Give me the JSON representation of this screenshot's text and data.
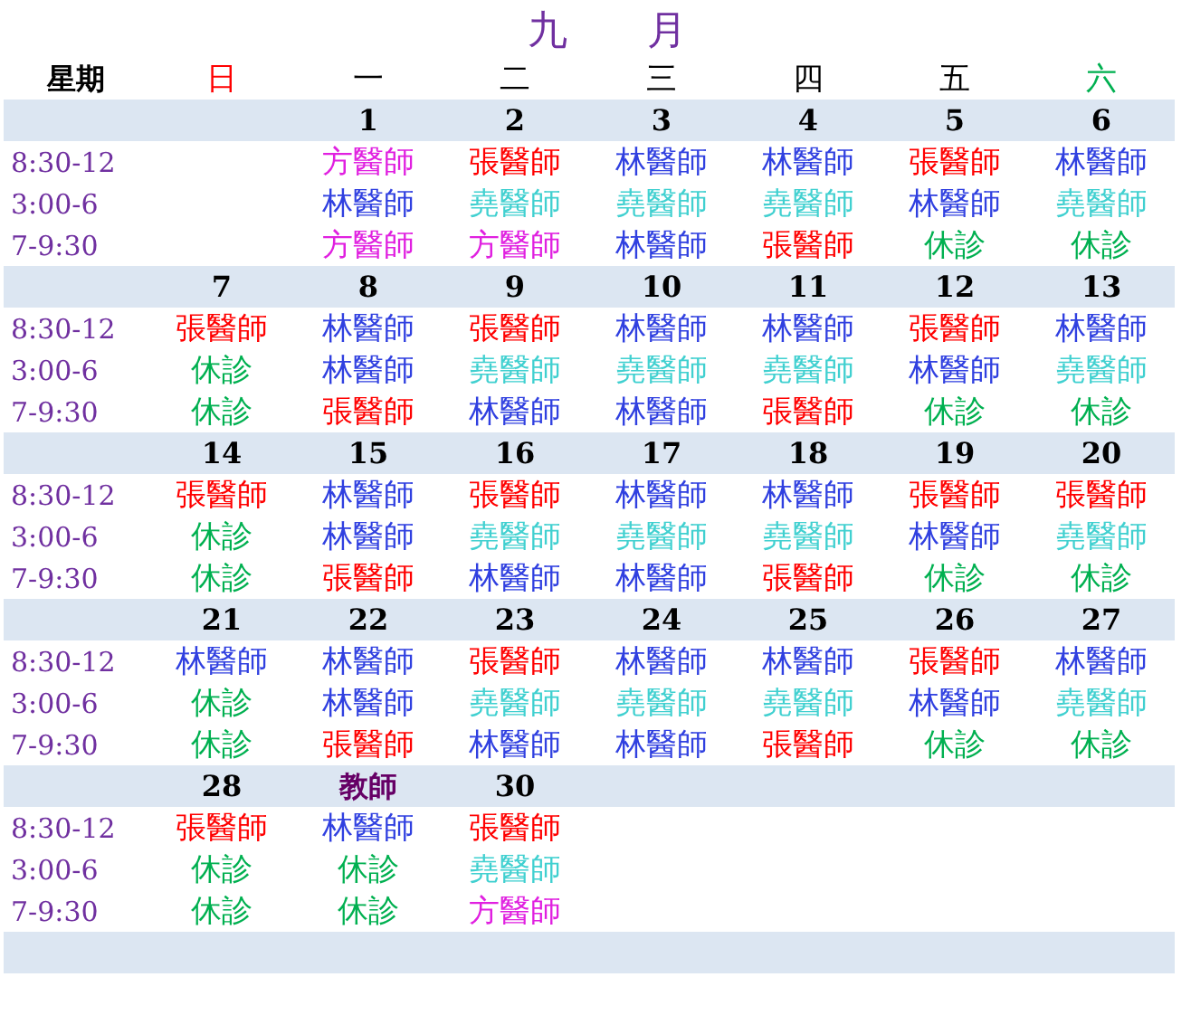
{
  "title": "九　　月",
  "weekday_header": {
    "label": "星期",
    "days": [
      {
        "label": "日",
        "color": "#ff0000"
      },
      {
        "label": "一",
        "color": "#000000"
      },
      {
        "label": "二",
        "color": "#000000"
      },
      {
        "label": "三",
        "color": "#000000"
      },
      {
        "label": "四",
        "color": "#000000"
      },
      {
        "label": "五",
        "color": "#000000"
      },
      {
        "label": "六",
        "color": "#00b050"
      }
    ]
  },
  "weeks": [
    {
      "times": [
        "8:30-12",
        "3:00-6",
        "7-9:30"
      ],
      "days": [
        {
          "kind": "blank"
        },
        {
          "kind": "day",
          "date": {
            "text": "1",
            "color": "#000000"
          },
          "slots": [
            {
              "text": "方醫師",
              "color": "#e020e0"
            },
            {
              "text": "林醫師",
              "color": "#3040e0"
            },
            {
              "text": "方醫師",
              "color": "#e020e0"
            }
          ]
        },
        {
          "kind": "day",
          "date": {
            "text": "2",
            "color": "#000000"
          },
          "slots": [
            {
              "text": "張醫師",
              "color": "#ff0000"
            },
            {
              "text": "堯醫師",
              "color": "#40d0d0"
            },
            {
              "text": "方醫師",
              "color": "#e020e0"
            }
          ]
        },
        {
          "kind": "day",
          "date": {
            "text": "3",
            "color": "#000000"
          },
          "slots": [
            {
              "text": "林醫師",
              "color": "#3040e0"
            },
            {
              "text": "堯醫師",
              "color": "#40d0d0"
            },
            {
              "text": "林醫師",
              "color": "#3040e0"
            }
          ]
        },
        {
          "kind": "day",
          "date": {
            "text": "4",
            "color": "#000000"
          },
          "slots": [
            {
              "text": "林醫師",
              "color": "#3040e0"
            },
            {
              "text": "堯醫師",
              "color": "#40d0d0"
            },
            {
              "text": "張醫師",
              "color": "#ff0000"
            }
          ]
        },
        {
          "kind": "day",
          "date": {
            "text": "5",
            "color": "#000000"
          },
          "slots": [
            {
              "text": "張醫師",
              "color": "#ff0000"
            },
            {
              "text": "林醫師",
              "color": "#3040e0"
            },
            {
              "text": "休診",
              "color": "#00b050"
            }
          ]
        },
        {
          "kind": "day",
          "date": {
            "text": "6",
            "color": "#000000"
          },
          "slots": [
            {
              "text": "林醫師",
              "color": "#3040e0"
            },
            {
              "text": "堯醫師",
              "color": "#40d0d0"
            },
            {
              "text": "休診",
              "color": "#00b050"
            }
          ]
        }
      ]
    },
    {
      "times": [
        "8:30-12",
        "3:00-6",
        "7-9:30"
      ],
      "days": [
        {
          "kind": "day",
          "date": {
            "text": "7",
            "color": "#000000"
          },
          "slots": [
            {
              "text": "張醫師",
              "color": "#ff0000"
            },
            {
              "text": "休診",
              "color": "#00b050"
            },
            {
              "text": "休診",
              "color": "#00b050"
            }
          ]
        },
        {
          "kind": "day",
          "date": {
            "text": "8",
            "color": "#000000"
          },
          "slots": [
            {
              "text": "林醫師",
              "color": "#3040e0"
            },
            {
              "text": "林醫師",
              "color": "#3040e0"
            },
            {
              "text": "張醫師",
              "color": "#ff0000"
            }
          ]
        },
        {
          "kind": "day",
          "date": {
            "text": "9",
            "color": "#000000"
          },
          "slots": [
            {
              "text": "張醫師",
              "color": "#ff0000"
            },
            {
              "text": "堯醫師",
              "color": "#40d0d0"
            },
            {
              "text": "林醫師",
              "color": "#3040e0"
            }
          ]
        },
        {
          "kind": "day",
          "date": {
            "text": "10",
            "color": "#000000"
          },
          "slots": [
            {
              "text": "林醫師",
              "color": "#3040e0"
            },
            {
              "text": "堯醫師",
              "color": "#40d0d0"
            },
            {
              "text": "林醫師",
              "color": "#3040e0"
            }
          ]
        },
        {
          "kind": "day",
          "date": {
            "text": "11",
            "color": "#000000"
          },
          "slots": [
            {
              "text": "林醫師",
              "color": "#3040e0"
            },
            {
              "text": "堯醫師",
              "color": "#40d0d0"
            },
            {
              "text": "張醫師",
              "color": "#ff0000"
            }
          ]
        },
        {
          "kind": "day",
          "date": {
            "text": "12",
            "color": "#000000"
          },
          "slots": [
            {
              "text": "張醫師",
              "color": "#ff0000"
            },
            {
              "text": "林醫師",
              "color": "#3040e0"
            },
            {
              "text": "休診",
              "color": "#00b050"
            }
          ]
        },
        {
          "kind": "day",
          "date": {
            "text": "13",
            "color": "#000000"
          },
          "slots": [
            {
              "text": "林醫師",
              "color": "#3040e0"
            },
            {
              "text": "堯醫師",
              "color": "#40d0d0"
            },
            {
              "text": "休診",
              "color": "#00b050"
            }
          ]
        }
      ]
    },
    {
      "times": [
        "8:30-12",
        "3:00-6",
        "7-9:30"
      ],
      "days": [
        {
          "kind": "day",
          "date": {
            "text": "14",
            "color": "#000000"
          },
          "slots": [
            {
              "text": "張醫師",
              "color": "#ff0000"
            },
            {
              "text": "休診",
              "color": "#00b050"
            },
            {
              "text": "休診",
              "color": "#00b050"
            }
          ]
        },
        {
          "kind": "day",
          "date": {
            "text": "15",
            "color": "#000000"
          },
          "slots": [
            {
              "text": "林醫師",
              "color": "#3040e0"
            },
            {
              "text": "林醫師",
              "color": "#3040e0"
            },
            {
              "text": "張醫師",
              "color": "#ff0000"
            }
          ]
        },
        {
          "kind": "day",
          "date": {
            "text": "16",
            "color": "#000000"
          },
          "slots": [
            {
              "text": "張醫師",
              "color": "#ff0000"
            },
            {
              "text": "堯醫師",
              "color": "#40d0d0"
            },
            {
              "text": "林醫師",
              "color": "#3040e0"
            }
          ]
        },
        {
          "kind": "day",
          "date": {
            "text": "17",
            "color": "#000000"
          },
          "slots": [
            {
              "text": "林醫師",
              "color": "#3040e0"
            },
            {
              "text": "堯醫師",
              "color": "#40d0d0"
            },
            {
              "text": "林醫師",
              "color": "#3040e0"
            }
          ]
        },
        {
          "kind": "day",
          "date": {
            "text": "18",
            "color": "#000000"
          },
          "slots": [
            {
              "text": "林醫師",
              "color": "#3040e0"
            },
            {
              "text": "堯醫師",
              "color": "#40d0d0"
            },
            {
              "text": "張醫師",
              "color": "#ff0000"
            }
          ]
        },
        {
          "kind": "day",
          "date": {
            "text": "19",
            "color": "#000000"
          },
          "slots": [
            {
              "text": "張醫師",
              "color": "#ff0000"
            },
            {
              "text": "林醫師",
              "color": "#3040e0"
            },
            {
              "text": "休診",
              "color": "#00b050"
            }
          ]
        },
        {
          "kind": "day",
          "date": {
            "text": "20",
            "color": "#000000"
          },
          "slots": [
            {
              "text": "張醫師",
              "color": "#ff0000"
            },
            {
              "text": "堯醫師",
              "color": "#40d0d0"
            },
            {
              "text": "休診",
              "color": "#00b050"
            }
          ]
        }
      ]
    },
    {
      "times": [
        "8:30-12",
        "3:00-6",
        "7-9:30"
      ],
      "days": [
        {
          "kind": "day",
          "date": {
            "text": "21",
            "color": "#000000"
          },
          "slots": [
            {
              "text": "林醫師",
              "color": "#3040e0"
            },
            {
              "text": "休診",
              "color": "#00b050"
            },
            {
              "text": "休診",
              "color": "#00b050"
            }
          ]
        },
        {
          "kind": "day",
          "date": {
            "text": "22",
            "color": "#000000"
          },
          "slots": [
            {
              "text": "林醫師",
              "color": "#3040e0"
            },
            {
              "text": "林醫師",
              "color": "#3040e0"
            },
            {
              "text": "張醫師",
              "color": "#ff0000"
            }
          ]
        },
        {
          "kind": "day",
          "date": {
            "text": "23",
            "color": "#000000"
          },
          "slots": [
            {
              "text": "張醫師",
              "color": "#ff0000"
            },
            {
              "text": "堯醫師",
              "color": "#40d0d0"
            },
            {
              "text": "林醫師",
              "color": "#3040e0"
            }
          ]
        },
        {
          "kind": "day",
          "date": {
            "text": "24",
            "color": "#000000"
          },
          "slots": [
            {
              "text": "林醫師",
              "color": "#3040e0"
            },
            {
              "text": "堯醫師",
              "color": "#40d0d0"
            },
            {
              "text": "林醫師",
              "color": "#3040e0"
            }
          ]
        },
        {
          "kind": "day",
          "date": {
            "text": "25",
            "color": "#000000"
          },
          "slots": [
            {
              "text": "林醫師",
              "color": "#3040e0"
            },
            {
              "text": "堯醫師",
              "color": "#40d0d0"
            },
            {
              "text": "張醫師",
              "color": "#ff0000"
            }
          ]
        },
        {
          "kind": "day",
          "date": {
            "text": "26",
            "color": "#000000"
          },
          "slots": [
            {
              "text": "張醫師",
              "color": "#ff0000"
            },
            {
              "text": "林醫師",
              "color": "#3040e0"
            },
            {
              "text": "休診",
              "color": "#00b050"
            }
          ]
        },
        {
          "kind": "day",
          "date": {
            "text": "27",
            "color": "#000000"
          },
          "slots": [
            {
              "text": "林醫師",
              "color": "#3040e0"
            },
            {
              "text": "堯醫師",
              "color": "#40d0d0"
            },
            {
              "text": "休診",
              "color": "#00b050"
            }
          ]
        }
      ]
    },
    {
      "times": [
        "8:30-12",
        "3:00-6",
        "7-9:30"
      ],
      "days": [
        {
          "kind": "day",
          "date": {
            "text": "28",
            "color": "#000000"
          },
          "slots": [
            {
              "text": "張醫師",
              "color": "#ff0000"
            },
            {
              "text": "休診",
              "color": "#00b050"
            },
            {
              "text": "休診",
              "color": "#00b050"
            }
          ]
        },
        {
          "kind": "day",
          "date": {
            "text": "教師",
            "color": "#660066"
          },
          "slots": [
            {
              "text": "林醫師",
              "color": "#3040e0"
            },
            {
              "text": "休診",
              "color": "#00b050"
            },
            {
              "text": "休診",
              "color": "#00b050"
            }
          ]
        },
        {
          "kind": "day",
          "date": {
            "text": "30",
            "color": "#000000"
          },
          "slots": [
            {
              "text": "張醫師",
              "color": "#ff0000"
            },
            {
              "text": "堯醫師",
              "color": "#40d0d0"
            },
            {
              "text": "方醫師",
              "color": "#e020e0"
            }
          ]
        }
      ]
    }
  ]
}
